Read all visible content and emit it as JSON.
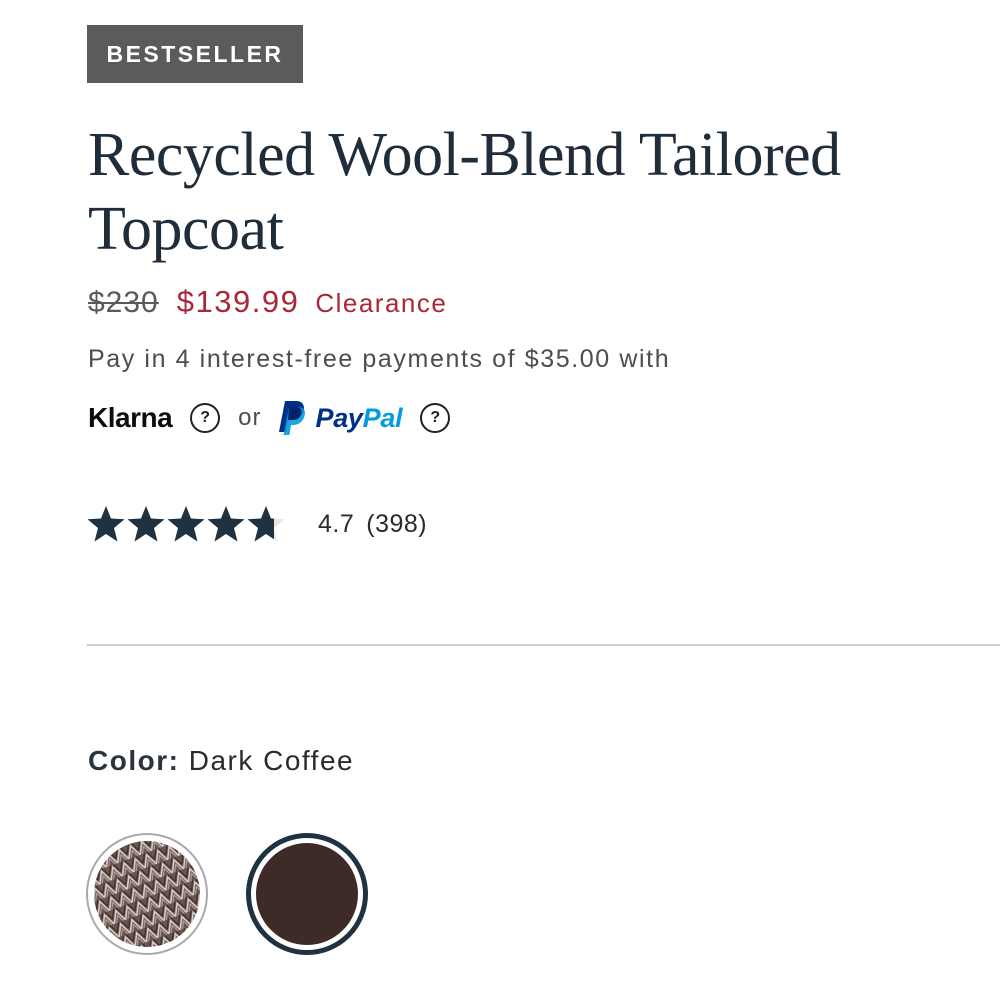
{
  "badge": {
    "label": "BESTSELLER"
  },
  "product": {
    "title": "Recycled Wool-Blend Tailored Topcoat"
  },
  "price": {
    "original": "$230",
    "sale": "$139.99",
    "tag": "Clearance"
  },
  "payment": {
    "installment_text": "Pay in 4 interest-free payments of $35.00 with",
    "klarna_label": "Klarna",
    "klarna_help": "?",
    "or_text": "or",
    "paypal_pay": "Pay",
    "paypal_pal": "Pal",
    "paypal_help": "?",
    "paypal_dark": "#003087",
    "paypal_light": "#009cde"
  },
  "rating": {
    "score": 4.7,
    "max": 5,
    "score_text": "4.7",
    "count_text": "(398)",
    "star_color": "#1f3242"
  },
  "color": {
    "label": "Color:",
    "selected": "Dark Coffee",
    "options": [
      {
        "name": "herringbone",
        "icon": "herringbone-swatch",
        "selected": false
      },
      {
        "name": "Dark Coffee",
        "icon": "solid-swatch",
        "hex": "#3e2a27",
        "selected": true
      }
    ]
  },
  "colors": {
    "title": "#1f2d3a",
    "sale": "#a8283a",
    "badge_bg": "#5b5b5b"
  }
}
